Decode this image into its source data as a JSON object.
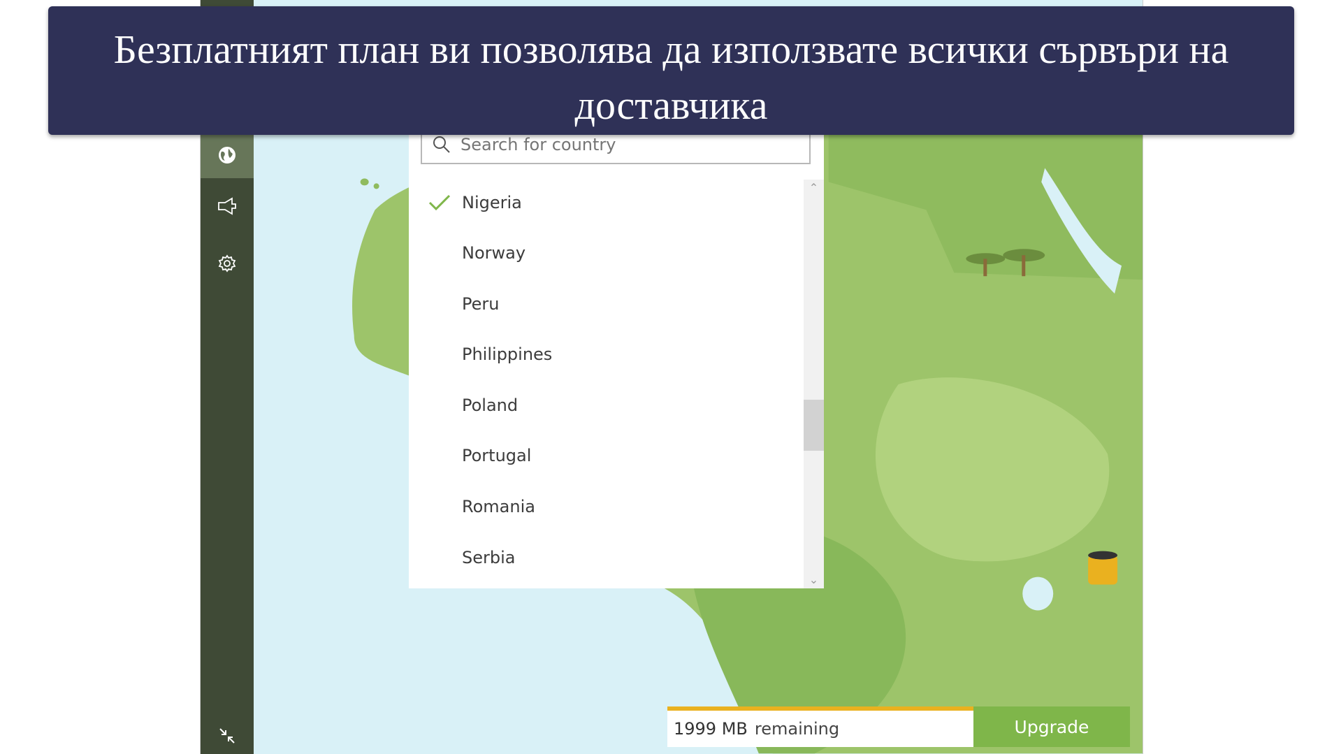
{
  "banner": {
    "title": "Безплатният план ви позволява да използвате всички сървъри на доставчика"
  },
  "sidebar": {
    "items": [
      {
        "icon": "globe-icon",
        "active": true
      },
      {
        "icon": "share-icon"
      },
      {
        "icon": "gear-icon"
      }
    ],
    "collapse_icon": "collapse-icon"
  },
  "search": {
    "placeholder": "Search for country",
    "value": ""
  },
  "countries": {
    "selected": "Nigeria",
    "items": [
      "Nigeria",
      "Norway",
      "Peru",
      "Philippines",
      "Poland",
      "Portugal",
      "Romania",
      "Serbia"
    ]
  },
  "data_bar": {
    "amount": "1999 MB",
    "suffix": "remaining",
    "upgrade_label": "Upgrade"
  },
  "colors": {
    "accent": "#7fb64a",
    "warning": "#eab11f",
    "sidebar": "#3f4a36",
    "banner": "#2f3157"
  }
}
